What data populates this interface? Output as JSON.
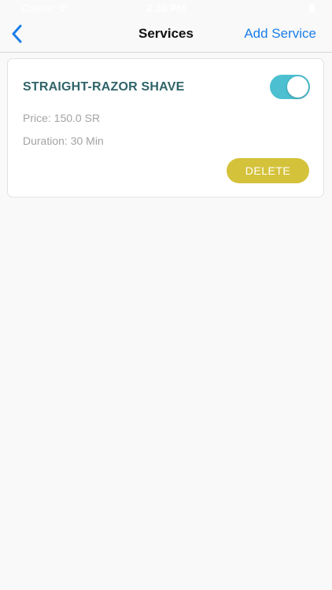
{
  "status_bar": {
    "carrier": "Carrier",
    "time": "2:30 PM"
  },
  "nav": {
    "title": "Services",
    "add_label": "Add Service",
    "back_icon": "chevron-left-icon"
  },
  "services": [
    {
      "name": "STRAIGHT-RAZOR SHAVE",
      "price": "Price: 150.0 SR",
      "duration": "Duration: 30 Min",
      "enabled": true,
      "delete_label": "DELETE"
    }
  ],
  "colors": {
    "accent_blue": "#1a7ee8",
    "service_name": "#2f6469",
    "toggle_on": "#4cc0d0",
    "delete_button": "#d4c23b"
  }
}
